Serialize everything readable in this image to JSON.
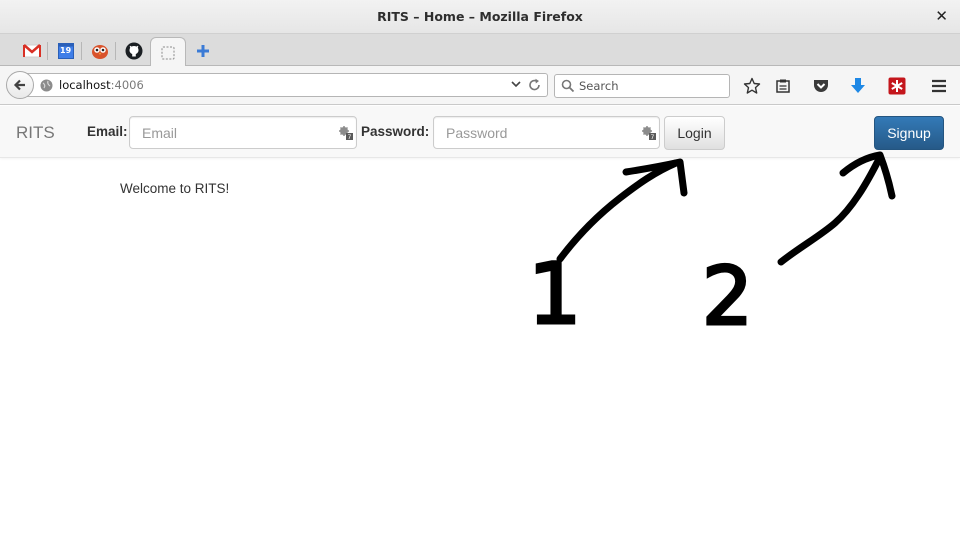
{
  "window": {
    "title": "RITS – Home – Mozilla Firefox"
  },
  "tabs": {
    "pinned": [
      "gmail-icon",
      "calendar-icon",
      "owl-icon",
      "github-icon"
    ],
    "calendar_day": "19"
  },
  "navbar": {
    "url_host": "localhost",
    "url_port": ":4006",
    "search_placeholder": "Search"
  },
  "app": {
    "brand": "RITS",
    "email_label": "Email:",
    "email_placeholder": "Email",
    "password_label": "Password:",
    "password_placeholder": "Password",
    "login_label": "Login",
    "signup_label": "Signup"
  },
  "main": {
    "welcome": "Welcome to RITS!"
  },
  "annotations": {
    "mark1": "1",
    "mark2": "2"
  },
  "colors": {
    "primary": "#337ab7",
    "ink": "#000000"
  }
}
